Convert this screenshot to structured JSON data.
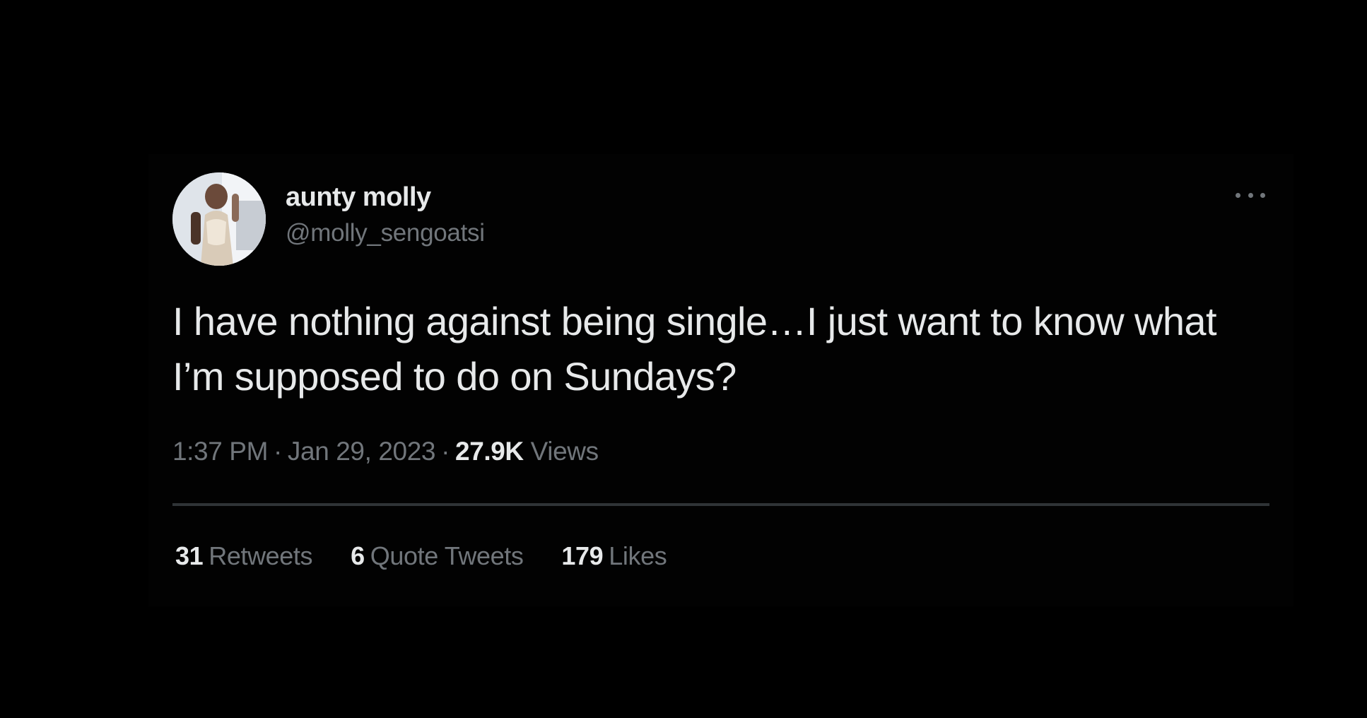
{
  "tweet": {
    "author": {
      "display_name": "aunty molly",
      "handle": "@molly_sengoatsi",
      "avatar": "profile-photo"
    },
    "more_icon": "more-horizontal-icon",
    "text": "I have nothing against being single…I just want to know what I’m supposed to do on Sundays?",
    "time": "1:37 PM",
    "date": "Jan 29, 2023",
    "separator": "·",
    "views_count": "27.9K",
    "views_label": "Views",
    "stats": {
      "retweets_count": "31",
      "retweets_label": "Retweets",
      "quotes_count": "6",
      "quotes_label": "Quote Tweets",
      "likes_count": "179",
      "likes_label": "Likes"
    }
  },
  "colors": {
    "background": "#000000",
    "primary_text": "#e7e9ea",
    "secondary_text": "#71767b",
    "divider": "#2f3336"
  }
}
